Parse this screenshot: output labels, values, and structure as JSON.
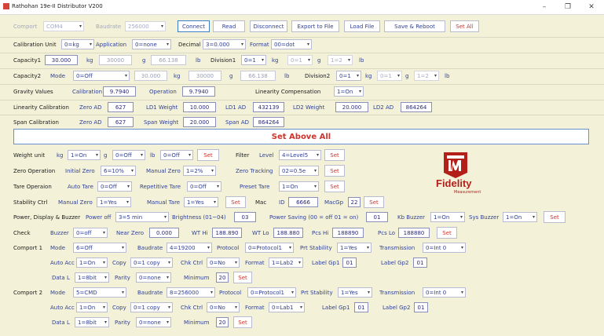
{
  "window": {
    "title": "Rathohan 19e-II Distributor V200"
  },
  "toolbar": {
    "comport_label": "Comport",
    "comport_value": "COM4",
    "baud_label": "Baudrate",
    "baud_value": "256000",
    "connect": "Connect",
    "read": "Read",
    "disconnect": "Disconnect",
    "export": "Export to File",
    "load": "Load File",
    "save_reboot": "Save & Reboot",
    "set_all": "Set All"
  },
  "cal_unit": {
    "label": "Calibration Unit",
    "unit": "0=kg",
    "app_label": "Application",
    "app": "0=none",
    "dec_label": "Decimal",
    "dec": "3=0.000",
    "fmt_label": "Format",
    "fmt": "00=dot"
  },
  "cap1": {
    "label": "Capacity1",
    "kg_val": "30.000",
    "kg": "kg",
    "g_val": "30000",
    "g": "g",
    "lb_val": "66.138",
    "lb": "lb",
    "div_label": "Division1",
    "div": "0=1",
    "kg2": "kg",
    "div_g": "0=1",
    "g2": "g",
    "div_lb": "1=2",
    "lb2": "lb"
  },
  "cap2": {
    "label": "Capacity2",
    "mode_label": "Mode",
    "mode": "0=Off",
    "kg_val": "30.000",
    "kg": "kg",
    "g_val": "30000",
    "g": "g",
    "lb_val": "66.138",
    "lb": "lb",
    "div_label": "Division2",
    "div": "0=1",
    "kg2": "kg",
    "div_g": "0=1",
    "g2": "g",
    "div_lb": "1=2",
    "lb2": "lb"
  },
  "gravity": {
    "label": "Gravity Values",
    "cal_label": "Calibration",
    "cal": "9.7940",
    "op_label": "Operation",
    "op": "9.7940",
    "lin_comp_label": "Linearity Compensation",
    "lin_comp": "1=On"
  },
  "linearity": {
    "label": "Linearity Calibration",
    "zero_label": "Zero AD",
    "zero": "627",
    "ld1w_label": "LD1 Weight",
    "ld1w": "10.000",
    "ld1ad_label": "LD1 AD",
    "ld1ad": "432139",
    "ld2w_label": "LD2 Weight",
    "ld2w": "20.000",
    "ld2ad_label": "LD2 AD",
    "ld2ad": "864264"
  },
  "span": {
    "label": "Span Calibration",
    "zero_label": "Zero AD",
    "zero": "627",
    "w_label": "Span Weight",
    "w": "20.000",
    "ad_label": "Span AD",
    "ad": "864264"
  },
  "set_above_all": "Set Above All",
  "weight_unit": {
    "label": "Weight unit",
    "kg": "kg",
    "kg_val": "1=On",
    "g": "g",
    "g_val": "0=Off",
    "lb": "lb",
    "lb_val": "0=Off",
    "set": "Set",
    "filter_label": "Filter",
    "level_label": "Level",
    "level": "4=Level5",
    "set2": "Set"
  },
  "zero_op": {
    "label": "Zero Operation",
    "init_label": "Initial Zero",
    "init": "6=10%",
    "manual_label": "Manual Zero",
    "manual": "1=2%",
    "track_label": "Zero Tracking",
    "track": "02=0.5e",
    "set": "Set"
  },
  "tare_op": {
    "label": "Tare Operaion",
    "auto_label": "Auto Tare",
    "auto": "0=Off",
    "rep_label": "Repetitive Tare",
    "rep": "0=Off",
    "preset_label": "Preset Tare",
    "preset": "1=On",
    "set": "Set"
  },
  "stability": {
    "label": "Stability Ctrl",
    "manual_label": "Manual Zero",
    "manual": "1=Yes",
    "tare_label": "Manual Tare",
    "tare": "1=Yes",
    "set": "Set",
    "mac_label": "Mac",
    "id_label": "ID",
    "id": "6666",
    "macgp_label": "MacGp",
    "macgp": "22",
    "set2": "Set"
  },
  "power": {
    "label": "Power, Display & Buzzer",
    "off_label": "Power off",
    "off": "3=5 min",
    "bright_label": "Brightness (01~04)",
    "bright": "03",
    "saving_label": "Power Saving (00 = off 01 = on)",
    "saving": "01",
    "kb_label": "Kb Buzzer",
    "kb": "1=On",
    "sys_label": "Sys Buzzer",
    "sys": "1=On",
    "set": "Set"
  },
  "check": {
    "label": "Check",
    "buzzer_label": "Buzzer",
    "buzzer": "0=off",
    "near_label": "Near Zero",
    "near": "0.000",
    "wthi_label": "WT Hi",
    "wthi": "188.890",
    "wtlo_label": "WT Lo",
    "wtlo": "188.880",
    "pcshi_label": "Pcs Hi",
    "pcshi": "188890",
    "pcslo_label": "Pcs Lo",
    "pcslo": "188880",
    "set": "Set"
  },
  "comport1": {
    "label": "Comport 1",
    "mode_label": "Mode",
    "mode": "6=Off",
    "baud_label": "Baudrate",
    "baud": "4=19200",
    "proto_label": "Protocol",
    "proto": "0=Protocol1",
    "prt_label": "Prt Stability",
    "prt": "1=Yes",
    "trans_label": "Transmission",
    "trans": "0=Int 0",
    "autoacc_label": "Auto Acc",
    "autoacc": "1=On",
    "copy_label": "Copy",
    "copy": "0=1 copy",
    "chk_label": "Chk Ctrl",
    "chk": "0=No",
    "format_label": "Format",
    "format": "1=Lab2",
    "gp1_label": "Label Gp1",
    "gp1": "01",
    "gp2_label": "Label Gp2",
    "gp2": "01",
    "datal_label": "Data L",
    "datal": "1=8bit",
    "parity_label": "Parity",
    "parity": "0=none",
    "min_label": "Minimum",
    "min": "20",
    "set": "Set"
  },
  "comport2": {
    "label": "Comport 2",
    "mode_label": "Mode",
    "mode": "5=CMD",
    "baud_label": "Baudrate",
    "baud": "8=256000",
    "proto_label": "Protocol",
    "proto": "0=Protocol1",
    "prt_label": "Prt Stability",
    "prt": "1=Yes",
    "trans_label": "Transmission",
    "trans": "0=Int 0",
    "autoacc_label": "Auto Acc",
    "autoacc": "1=On",
    "copy_label": "Copy",
    "copy": "0=1 copy",
    "chk_label": "Chk Ctrl",
    "chk": "0=No",
    "format_label": "Format",
    "format": "0=Lab1",
    "gp1_label": "Label Gp1",
    "gp1": "01",
    "gp2_label": "Label Gp2",
    "gp2": "01",
    "datal_label": "Data L",
    "datal": "1=8bit",
    "parity_label": "Parity",
    "parity": "0=none",
    "min_label": "Minimum",
    "min": "20",
    "set": "Set"
  },
  "logo": {
    "name": "Fidelity",
    "sub": "Measurement"
  },
  "colors": {
    "background": "#f3f2d9",
    "label_blue": "#2f3f96",
    "set_red": "#d0332a",
    "logo_red": "#b3201a"
  },
  "icons": {
    "app": "app-icon",
    "minimize": "minimize-icon",
    "maximize": "maximize-icon",
    "close": "close-icon"
  }
}
